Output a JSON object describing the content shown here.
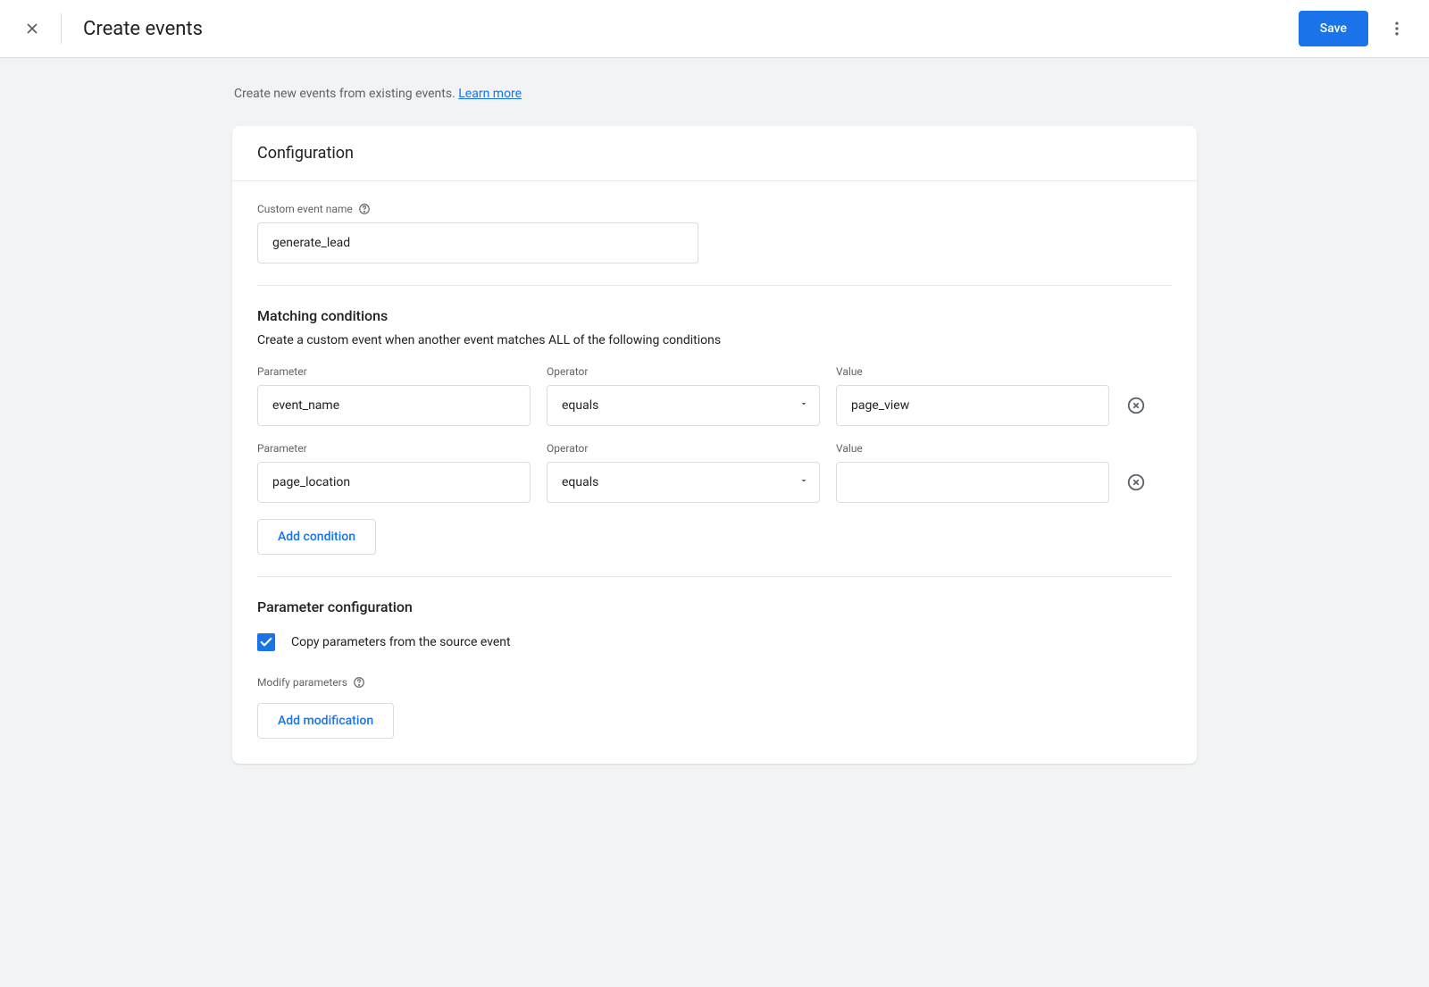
{
  "header": {
    "title": "Create events",
    "save_label": "Save"
  },
  "intro": {
    "text": "Create new events from existing events. ",
    "link_label": "Learn more"
  },
  "card": {
    "title": "Configuration",
    "custom_event_label": "Custom event name",
    "custom_event_value": "generate_lead"
  },
  "matching": {
    "title": "Matching conditions",
    "description": "Create a custom event when another event matches ALL of the following conditions",
    "labels": {
      "parameter": "Parameter",
      "operator": "Operator",
      "value": "Value"
    },
    "conditions": [
      {
        "parameter": "event_name",
        "operator": "equals",
        "value": "page_view"
      },
      {
        "parameter": "page_location",
        "operator": "equals",
        "value": ""
      }
    ],
    "add_condition_label": "Add condition"
  },
  "param_config": {
    "title": "Parameter configuration",
    "copy_checked": true,
    "copy_label": "Copy parameters from the source event",
    "modify_label": "Modify parameters",
    "add_modification_label": "Add modification"
  }
}
